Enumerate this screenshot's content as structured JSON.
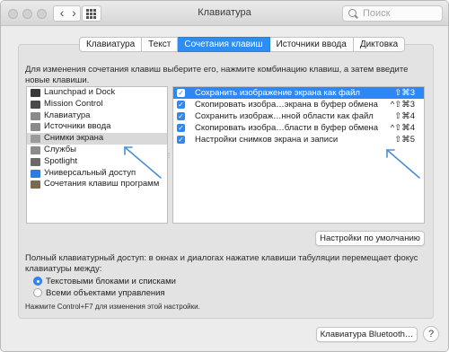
{
  "window": {
    "title": "Клавиатура"
  },
  "search": {
    "placeholder": "Поиск"
  },
  "tabs": [
    {
      "label": "Клавиатура",
      "active": false
    },
    {
      "label": "Текст",
      "active": false
    },
    {
      "label": "Сочетания клавиш",
      "active": true
    },
    {
      "label": "Источники ввода",
      "active": false
    },
    {
      "label": "Диктовка",
      "active": false
    }
  ],
  "instructions": "Для изменения сочетания клавиш выберите его, нажмите комбинацию клавиш, а затем введите новые клавиши.",
  "categories": [
    {
      "label": "Launchpad и Dock",
      "icon": "launchpad-dock-icon",
      "color": "#3a3a3a",
      "selected": false
    },
    {
      "label": "Mission Control",
      "icon": "mission-control-icon",
      "color": "#4a4a4a",
      "selected": false
    },
    {
      "label": "Клавиатура",
      "icon": "keyboard-icon",
      "color": "#8a8a8a",
      "selected": false
    },
    {
      "label": "Источники ввода",
      "icon": "input-sources-icon",
      "color": "#8a8a8a",
      "selected": false
    },
    {
      "label": "Снимки экрана",
      "icon": "screenshot-icon",
      "color": "#9a9a9a",
      "selected": true
    },
    {
      "label": "Службы",
      "icon": "services-gear-icon",
      "color": "#8c8c8c",
      "selected": false
    },
    {
      "label": "Spotlight",
      "icon": "spotlight-icon",
      "color": "#6a6a6a",
      "selected": false
    },
    {
      "label": "Универсальный доступ",
      "icon": "accessibility-icon",
      "color": "#2f7de0",
      "selected": false
    },
    {
      "label": "Сочетания клавиш программ",
      "icon": "app-shortcuts-icon",
      "color": "#7a6a50",
      "selected": false
    }
  ],
  "shortcuts": [
    {
      "label": "Сохранить изображение экрана как файл",
      "keys": "⇧⌘3",
      "checked": true,
      "selected": true
    },
    {
      "label": "Скопировать изобра…экрана в буфер обмена",
      "keys": "^⇧⌘3",
      "checked": true,
      "selected": false
    },
    {
      "label": "Сохранить изображ…нной области как файл",
      "keys": "⇧⌘4",
      "checked": true,
      "selected": false
    },
    {
      "label": "Скопировать изобра…бласти в буфер обмена",
      "keys": "^⇧⌘4",
      "checked": true,
      "selected": false
    },
    {
      "label": "Настройки снимков экрана и записи",
      "keys": "⇧⌘5",
      "checked": true,
      "selected": false
    }
  ],
  "restore_defaults_label": "Настройки по умолчанию",
  "full_keyboard_access": {
    "text": "Полный клавиатурный доступ: в окнах и диалогах нажатие клавиши табуляции перемещает фокус клавиатуры между:",
    "options": [
      {
        "label": "Текстовыми блоками и списками",
        "selected": true
      },
      {
        "label": "Всеми объектами управления",
        "selected": false
      }
    ],
    "hint": "Нажмите Control+F7 для изменения этой настройки."
  },
  "bluetooth_button_label": "Клавиатура Bluetooth…",
  "help_label": "?",
  "colors": {
    "accent": "#2f87f5",
    "annotation_arrow": "#4a90d9"
  }
}
